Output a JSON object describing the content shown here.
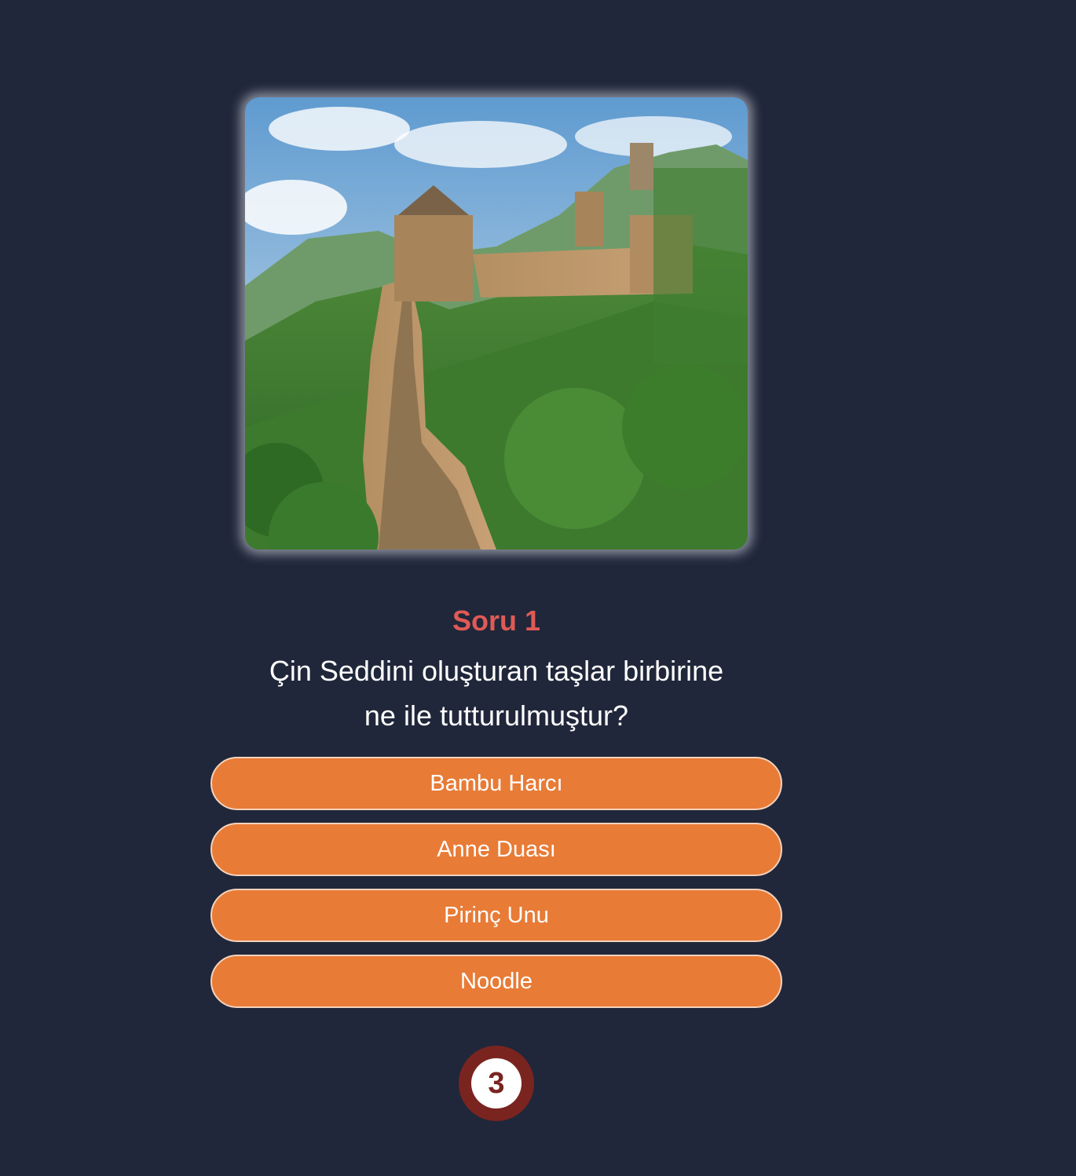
{
  "image": {
    "icon": "great-wall-photo"
  },
  "question": {
    "number_label": "Soru 1",
    "text": "Çin Seddini oluşturan taşlar birbirine ne ile tutturulmuştur?"
  },
  "answers": [
    {
      "label": "Bambu Harcı"
    },
    {
      "label": "Anne Duası"
    },
    {
      "label": "Pirinç Unu"
    },
    {
      "label": "Noodle"
    }
  ],
  "timer": {
    "value": "3"
  },
  "colors": {
    "background": "#20273a",
    "question_number": "#e05a55",
    "answer_button": "#e87b36",
    "answer_border": "#f3d2bd",
    "timer_ring": "#7a2420"
  }
}
